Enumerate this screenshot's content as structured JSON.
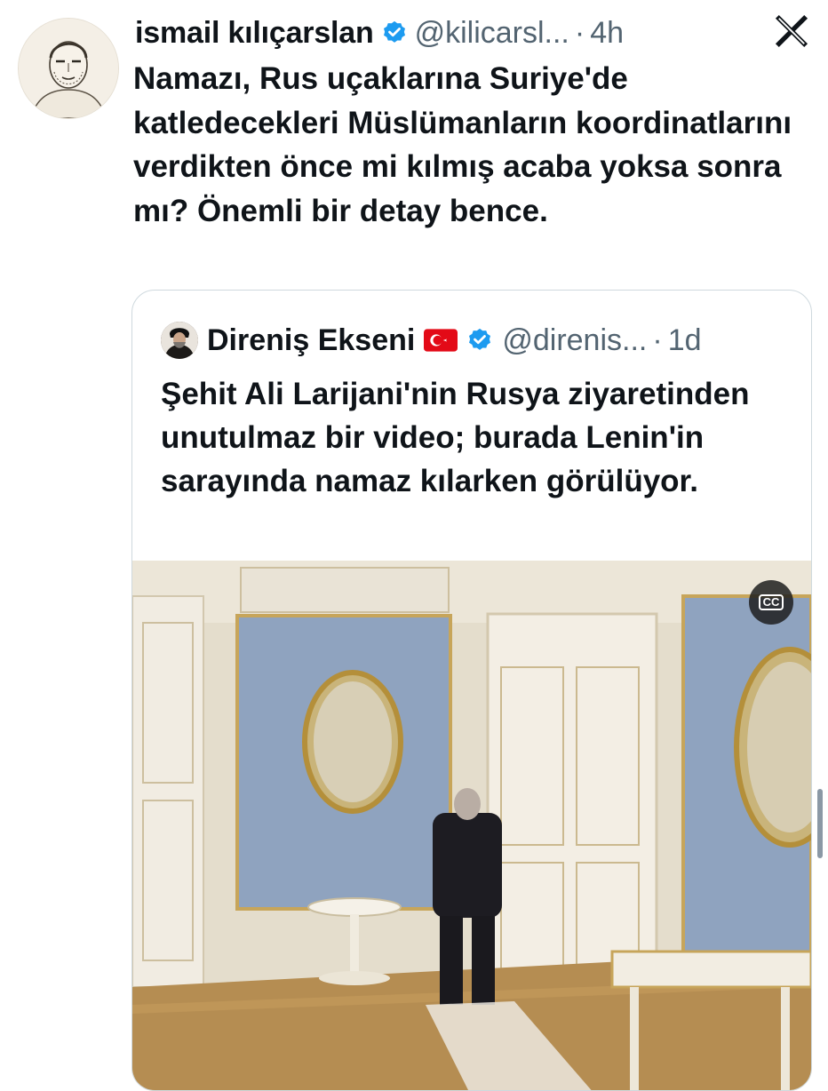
{
  "tweet": {
    "author_name": "ismail kılıçarslan",
    "author_handle": "@kilicarsl...",
    "separator": "·",
    "time": "4h",
    "text": "Namazı, Rus uçaklarına Suriye'de katledecekleri Müslümanların koordinatlarını verdikten önce mi kılmış acaba yoksa sonra mı? Önemli bir detay bence."
  },
  "quoted": {
    "author_name": "Direniş Ekseni",
    "author_handle": "@direnis...",
    "separator": "·",
    "time": "1d",
    "text": "Şehit Ali Larijani'nin Rusya ziyaretinden unutulmaz bir video; burada Lenin'in sarayında namaz kılarken görülüyor.",
    "media_cc_label": "CC"
  },
  "icons": {
    "verified": "verified-badge-icon",
    "platform": "x-logo-icon",
    "flag": "turkey-flag-icon",
    "captions": "closed-captions-icon"
  },
  "colors": {
    "verified": "#1d9bf0",
    "secondary_text": "#536471",
    "border": "#cfd9de",
    "flag_red": "#e30a17"
  }
}
